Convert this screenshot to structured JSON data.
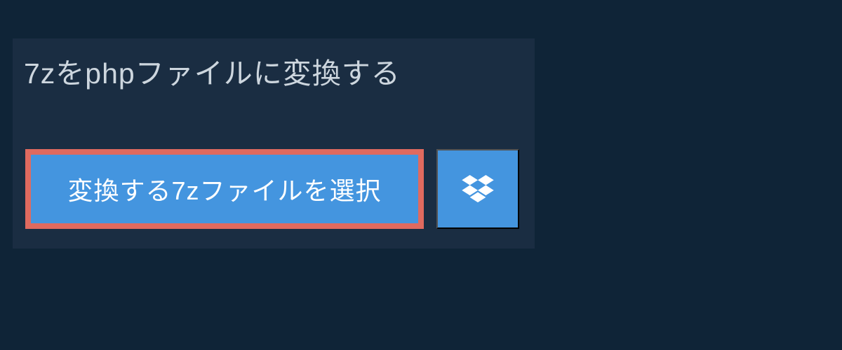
{
  "page": {
    "title": "7zをphpファイルに変換する"
  },
  "buttons": {
    "select_file_label": "変換する7zファイルを選択"
  },
  "colors": {
    "background": "#0f2437",
    "panel": "#1a2d42",
    "button_primary": "#4495df",
    "button_border": "#e06a5f",
    "title_text": "#cdd6de"
  }
}
